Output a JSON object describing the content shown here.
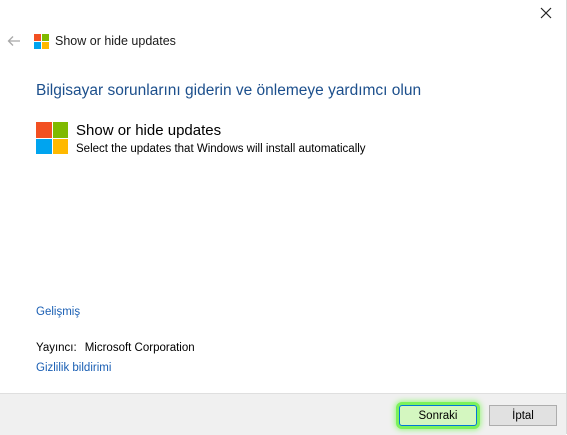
{
  "window": {
    "title": "Show or hide updates",
    "close_icon": "close-icon",
    "back_icon": "back-arrow-icon",
    "logo_icon": "windows-logo-icon"
  },
  "main": {
    "heading": "Bilgisayar sorunlarını giderin ve önlemeye yardımcı olun",
    "tool": {
      "title": "Show or hide updates",
      "description": "Select the updates that Windows will install automatically"
    },
    "advanced_link": "Gelişmiş",
    "publisher_label": "Yayıncı:",
    "publisher_value": "Microsoft Corporation",
    "privacy_link": "Gizlilik bildirimi"
  },
  "footer": {
    "next_label": "Sonraki",
    "cancel_label": "İptal"
  },
  "colors": {
    "logo_red": "#f25022",
    "logo_green": "#7fba00",
    "logo_blue": "#00a4ef",
    "logo_yellow": "#ffb900",
    "heading": "#1c4f8c",
    "link": "#1a5fb4",
    "highlight": "#7cf25c"
  }
}
